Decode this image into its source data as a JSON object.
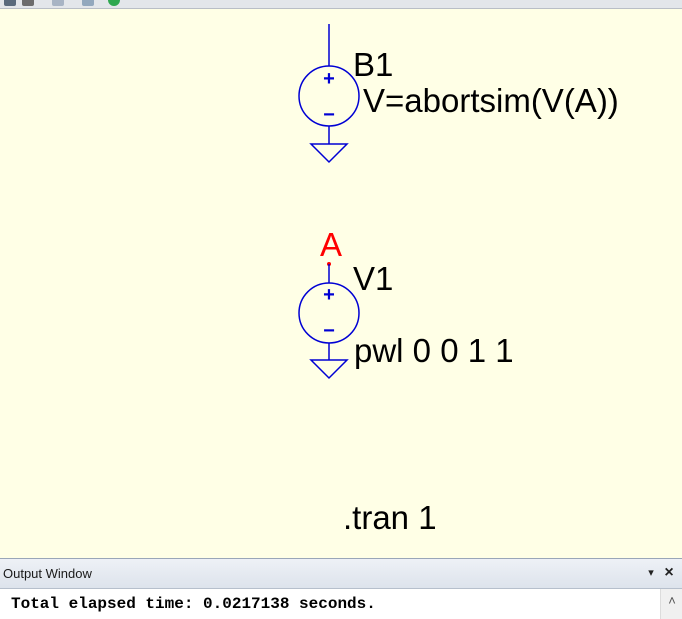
{
  "toolbar": {
    "icons": [
      "cut-icon",
      "copy-icon",
      "paste-icon",
      "run-icon"
    ]
  },
  "schematic": {
    "b1": {
      "name": "B1",
      "value": "V=abortsim(V(A))"
    },
    "v1": {
      "name": "V1",
      "value": "pwl 0 0 1 1"
    },
    "net_label": "A",
    "directive": ".tran 1",
    "plus_sign": "+",
    "minus_sign": "−"
  },
  "colors": {
    "wire": "#0000d4",
    "net_label": "#ff0000",
    "background": "#ffffe6"
  },
  "output_window": {
    "title": "Output Window",
    "dropdown_glyph": "▾",
    "close_glyph": "×",
    "text": "Total elapsed time: 0.0217138 seconds.",
    "scroll_up_glyph": "˄"
  }
}
